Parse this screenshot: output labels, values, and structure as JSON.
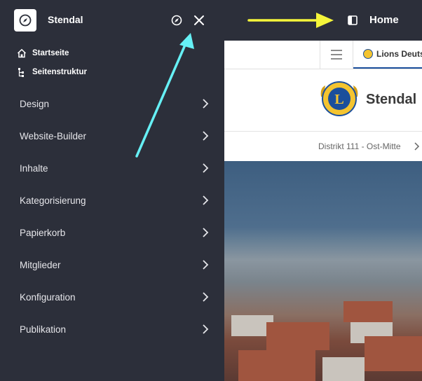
{
  "sidebar": {
    "site_name": "Stendal",
    "quick_links": [
      {
        "label": "Startseite",
        "icon": "home-icon"
      },
      {
        "label": "Seitenstruktur",
        "icon": "sitemap-icon"
      }
    ],
    "menu": [
      {
        "label": "Design"
      },
      {
        "label": "Website-Builder"
      },
      {
        "label": "Inhalte"
      },
      {
        "label": "Kategorisierung"
      },
      {
        "label": "Papierkorb"
      },
      {
        "label": "Mitglieder"
      },
      {
        "label": "Konfiguration"
      },
      {
        "label": "Publikation"
      }
    ]
  },
  "topbar": {
    "title": "Home"
  },
  "preview": {
    "tab_label": "Lions Deutschland",
    "brand_name": "Stendal",
    "breadcrumb": "Distrikt 111 - Ost-Mitte"
  },
  "colors": {
    "sidebar_bg": "#2c2f3a",
    "annotation_cyan": "#66f0f5",
    "annotation_yellow": "#f5f53a",
    "tab_accent": "#1b4f9c"
  }
}
